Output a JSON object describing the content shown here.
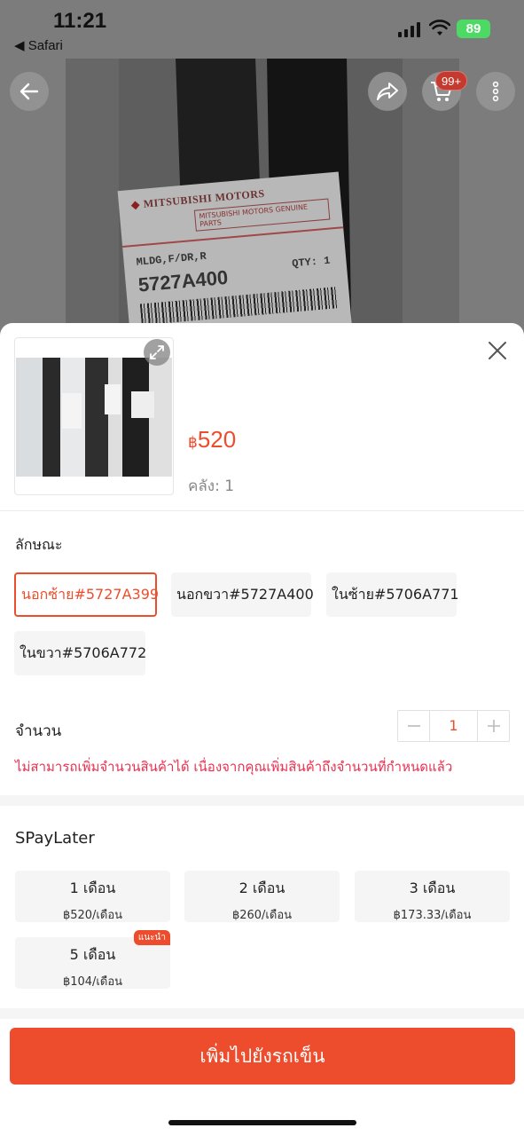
{
  "status_bar": {
    "time": "11:21",
    "back_app": "◀ Safari",
    "battery": "89"
  },
  "header": {
    "cart_badge": "99+",
    "icons": [
      "back-arrow-icon",
      "share-icon",
      "cart-icon",
      "more-vertical-icon"
    ]
  },
  "background_photo": {
    "brand": "MITSUBISHI MOTORS",
    "genuine": "MITSUBISHI MOTORS GENUINE PARTS",
    "desc": "MLDG,F/DR,R",
    "qty": "QTY: 1",
    "part_no": "5727A400"
  },
  "sheet": {
    "price_currency": "฿",
    "price_value": "520",
    "stock": "คลัง: 1",
    "variation_title": "ลักษณะ",
    "variants": [
      {
        "label": "นอกซ้าย#5727A399",
        "selected": true
      },
      {
        "label": "นอกขวา#5727A400",
        "selected": false
      },
      {
        "label": "ในซ้าย#5706A771",
        "selected": false
      },
      {
        "label": "ในขวา#5706A772",
        "selected": false
      }
    ],
    "quantity_title": "จำนวน",
    "quantity_value": "1",
    "quantity_warning": "ไม่สามารถเพิ่มจำนวนสินค้าได้ เนื่องจากคุณเพิ่มสินค้าถึงจำนวนที่กำหนดแล้ว",
    "spaylater_title": "SPayLater",
    "plans": [
      {
        "months": "1 เดือน",
        "per_month": "฿520/เดือน"
      },
      {
        "months": "2 เดือน",
        "per_month": "฿260/เดือน"
      },
      {
        "months": "3 เดือน",
        "per_month": "฿173.33/เดือน"
      },
      {
        "months": "5 เดือน",
        "per_month": "฿104/เดือน",
        "badge": "แนะนำ"
      }
    ],
    "cta_label": "เพิ่มไปยังรถเข็น"
  },
  "colors": {
    "accent": "#ee4d2d",
    "warning": "#e8304f"
  }
}
